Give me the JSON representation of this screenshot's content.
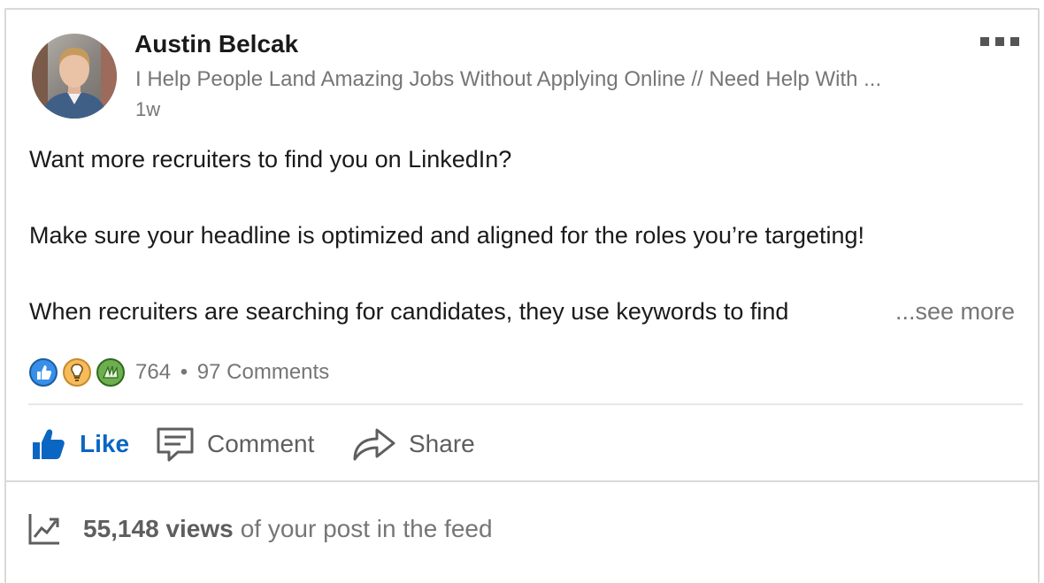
{
  "post": {
    "author": {
      "name": "Austin Belcak",
      "headline": "I Help People Land Amazing Jobs Without Applying Online // Need Help With ...",
      "timestamp": "1w"
    },
    "menu_icon": "more-options-icon",
    "body_lines": [
      "Want more recruiters to find you on LinkedIn?",
      "Make sure your headline is optimized and aligned for the roles you’re targeting!",
      "When recruiters are searching for candidates, they use keywords to find"
    ],
    "see_more_label": "...see more",
    "social": {
      "reaction_icons": [
        "like-reaction-icon",
        "insightful-reaction-icon",
        "celebrate-reaction-icon"
      ],
      "reaction_count": "764",
      "separator": "•",
      "comments_label": "97 Comments"
    },
    "actions": [
      {
        "label": "Like",
        "icon": "thumbs-up-icon",
        "active": true
      },
      {
        "label": "Comment",
        "icon": "comment-icon",
        "active": false
      },
      {
        "label": "Share",
        "icon": "share-arrow-icon",
        "active": false
      }
    ],
    "analytics": {
      "icon": "trending-chart-icon",
      "views": "55,148 views",
      "suffix": "of your post in the feed"
    }
  },
  "colors": {
    "accent_blue": "#0a66c2",
    "text_primary": "#1a1a1a",
    "text_secondary": "#767676",
    "action_gray": "#5e5e5e",
    "border": "#d9d9d9"
  }
}
